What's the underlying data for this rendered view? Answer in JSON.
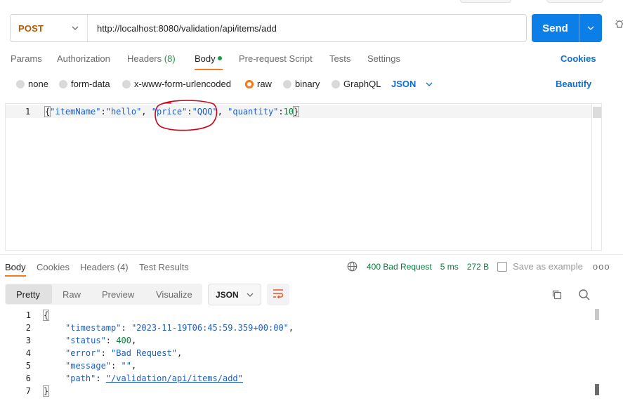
{
  "request": {
    "method": "POST",
    "url": "http://localhost:8080/validation/api/items/add",
    "send_label": "Send"
  },
  "request_tabs": {
    "params": "Params",
    "authorization": "Authorization",
    "headers": "Headers",
    "headers_count": "(8)",
    "body": "Body",
    "prerequest": "Pre-request Script",
    "tests": "Tests",
    "settings": "Settings",
    "cookies": "Cookies"
  },
  "body_types": {
    "none": "none",
    "form_data": "form-data",
    "urlencoded": "x-www-form-urlencoded",
    "raw": "raw",
    "binary": "binary",
    "graphql": "GraphQL",
    "format": "JSON",
    "beautify": "Beautify",
    "selected": "raw"
  },
  "request_body": {
    "line_number": "1",
    "open": "{",
    "k1": "\"itemName\"",
    "v1": "\"hello\"",
    "k2": "\"price\"",
    "v2": "\"QQQ\"",
    "k3": "\"quantity\"",
    "v3": "10",
    "close": "}"
  },
  "response_tabs": {
    "body": "Body",
    "cookies": "Cookies",
    "headers": "Headers (4)",
    "test_results": "Test Results"
  },
  "response_status": {
    "code": "400 Bad Request",
    "time": "5 ms",
    "size": "272 B",
    "save": "Save as example",
    "more": "ooo"
  },
  "response_view": {
    "pretty": "Pretty",
    "raw": "Raw",
    "preview": "Preview",
    "visualize": "Visualize",
    "format": "JSON"
  },
  "response_body": {
    "l1": "{",
    "l2_key": "\"timestamp\"",
    "l2_val": "\"2023-11-19T06:45:59.359+00:00\"",
    "l3_key": "\"status\"",
    "l3_val": "400",
    "l4_key": "\"error\"",
    "l4_val": "\"Bad Request\"",
    "l5_key": "\"message\"",
    "l5_val": "\"\"",
    "l6_key": "\"path\"",
    "l6_val": "\"/validation/api/items/add\"",
    "l7": "}",
    "numbers": [
      "1",
      "2",
      "3",
      "4",
      "5",
      "6",
      "7"
    ]
  },
  "colors": {
    "send": "#0c7ee8",
    "accent": "#f37b20",
    "method": "#b05b00",
    "success_green": "#0a7c3b",
    "annotation_red": "#d0021b"
  }
}
